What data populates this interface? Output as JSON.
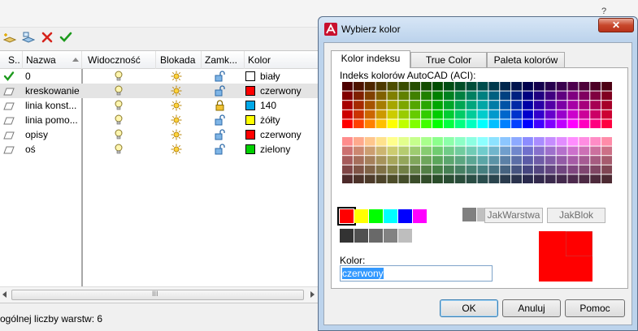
{
  "background_window": {
    "top_right_text": "?",
    "toolbar": [
      {
        "icon": "new-layer-icon"
      },
      {
        "icon": "new-layer-vp-icon"
      },
      {
        "icon": "delete-layer-icon"
      },
      {
        "icon": "set-current-icon"
      }
    ],
    "columns": [
      "S..",
      "Nazwa",
      "Widoczność",
      "Blokada",
      "Zamk...",
      "Kolor"
    ],
    "layers": [
      {
        "status": "current",
        "name": "0",
        "visible": "on",
        "freeze": "thawed",
        "lock": "unlocked",
        "color_hex": "#ffffff",
        "color": "biały"
      },
      {
        "status": "layer",
        "name": "kreskowanie",
        "visible": "on",
        "freeze": "thawed",
        "lock": "unlocked",
        "color_hex": "#ff0000",
        "color": "czerwony",
        "selected": true
      },
      {
        "status": "layer",
        "name": "linia konst...",
        "visible": "on",
        "freeze": "thawed",
        "lock": "locked",
        "color_hex": "#00a8e8",
        "color": "140"
      },
      {
        "status": "layer",
        "name": "linia pomo...",
        "visible": "on",
        "freeze": "thawed",
        "lock": "unlocked",
        "color_hex": "#ffff00",
        "color": "żółty"
      },
      {
        "status": "layer",
        "name": "opisy",
        "visible": "on",
        "freeze": "thawed",
        "lock": "unlocked",
        "color_hex": "#ff0000",
        "color": "czerwony"
      },
      {
        "status": "layer",
        "name": "oś",
        "visible": "on",
        "freeze": "thawed",
        "lock": "unlocked",
        "color_hex": "#00d000",
        "color": "zielony"
      }
    ],
    "scrollbar_grip": "III",
    "status_text": "ogólnej liczby warstw: 6"
  },
  "dialog": {
    "title": "Wybierz kolor",
    "close_label": "✕",
    "tabs": [
      {
        "label": "Kolor indeksu",
        "active": true
      },
      {
        "label": "True Color",
        "active": false
      },
      {
        "label": "Paleta kolorów",
        "active": false
      }
    ],
    "aci_label": "Indeks kolorów AutoCAD (ACI):",
    "standard_colors": [
      "#ff0000",
      "#ffff00",
      "#00ff00",
      "#00ffff",
      "#0000ff",
      "#ff00ff",
      "#ffffff",
      "#808080",
      "#c0c0c0"
    ],
    "selected_standard_index": 0,
    "gray_colors": [
      "#333333",
      "#505050",
      "#696969",
      "#828282",
      "#bebebe",
      "#ffffff"
    ],
    "bylayer_label": "JakWarstwa",
    "byblock_label": "JakBlok",
    "color_label": "Kolor:",
    "color_value": "czerwony",
    "preview_color": "#ff0000",
    "ok_label": "OK",
    "cancel_label": "Anuluj",
    "help_label": "Pomoc"
  }
}
